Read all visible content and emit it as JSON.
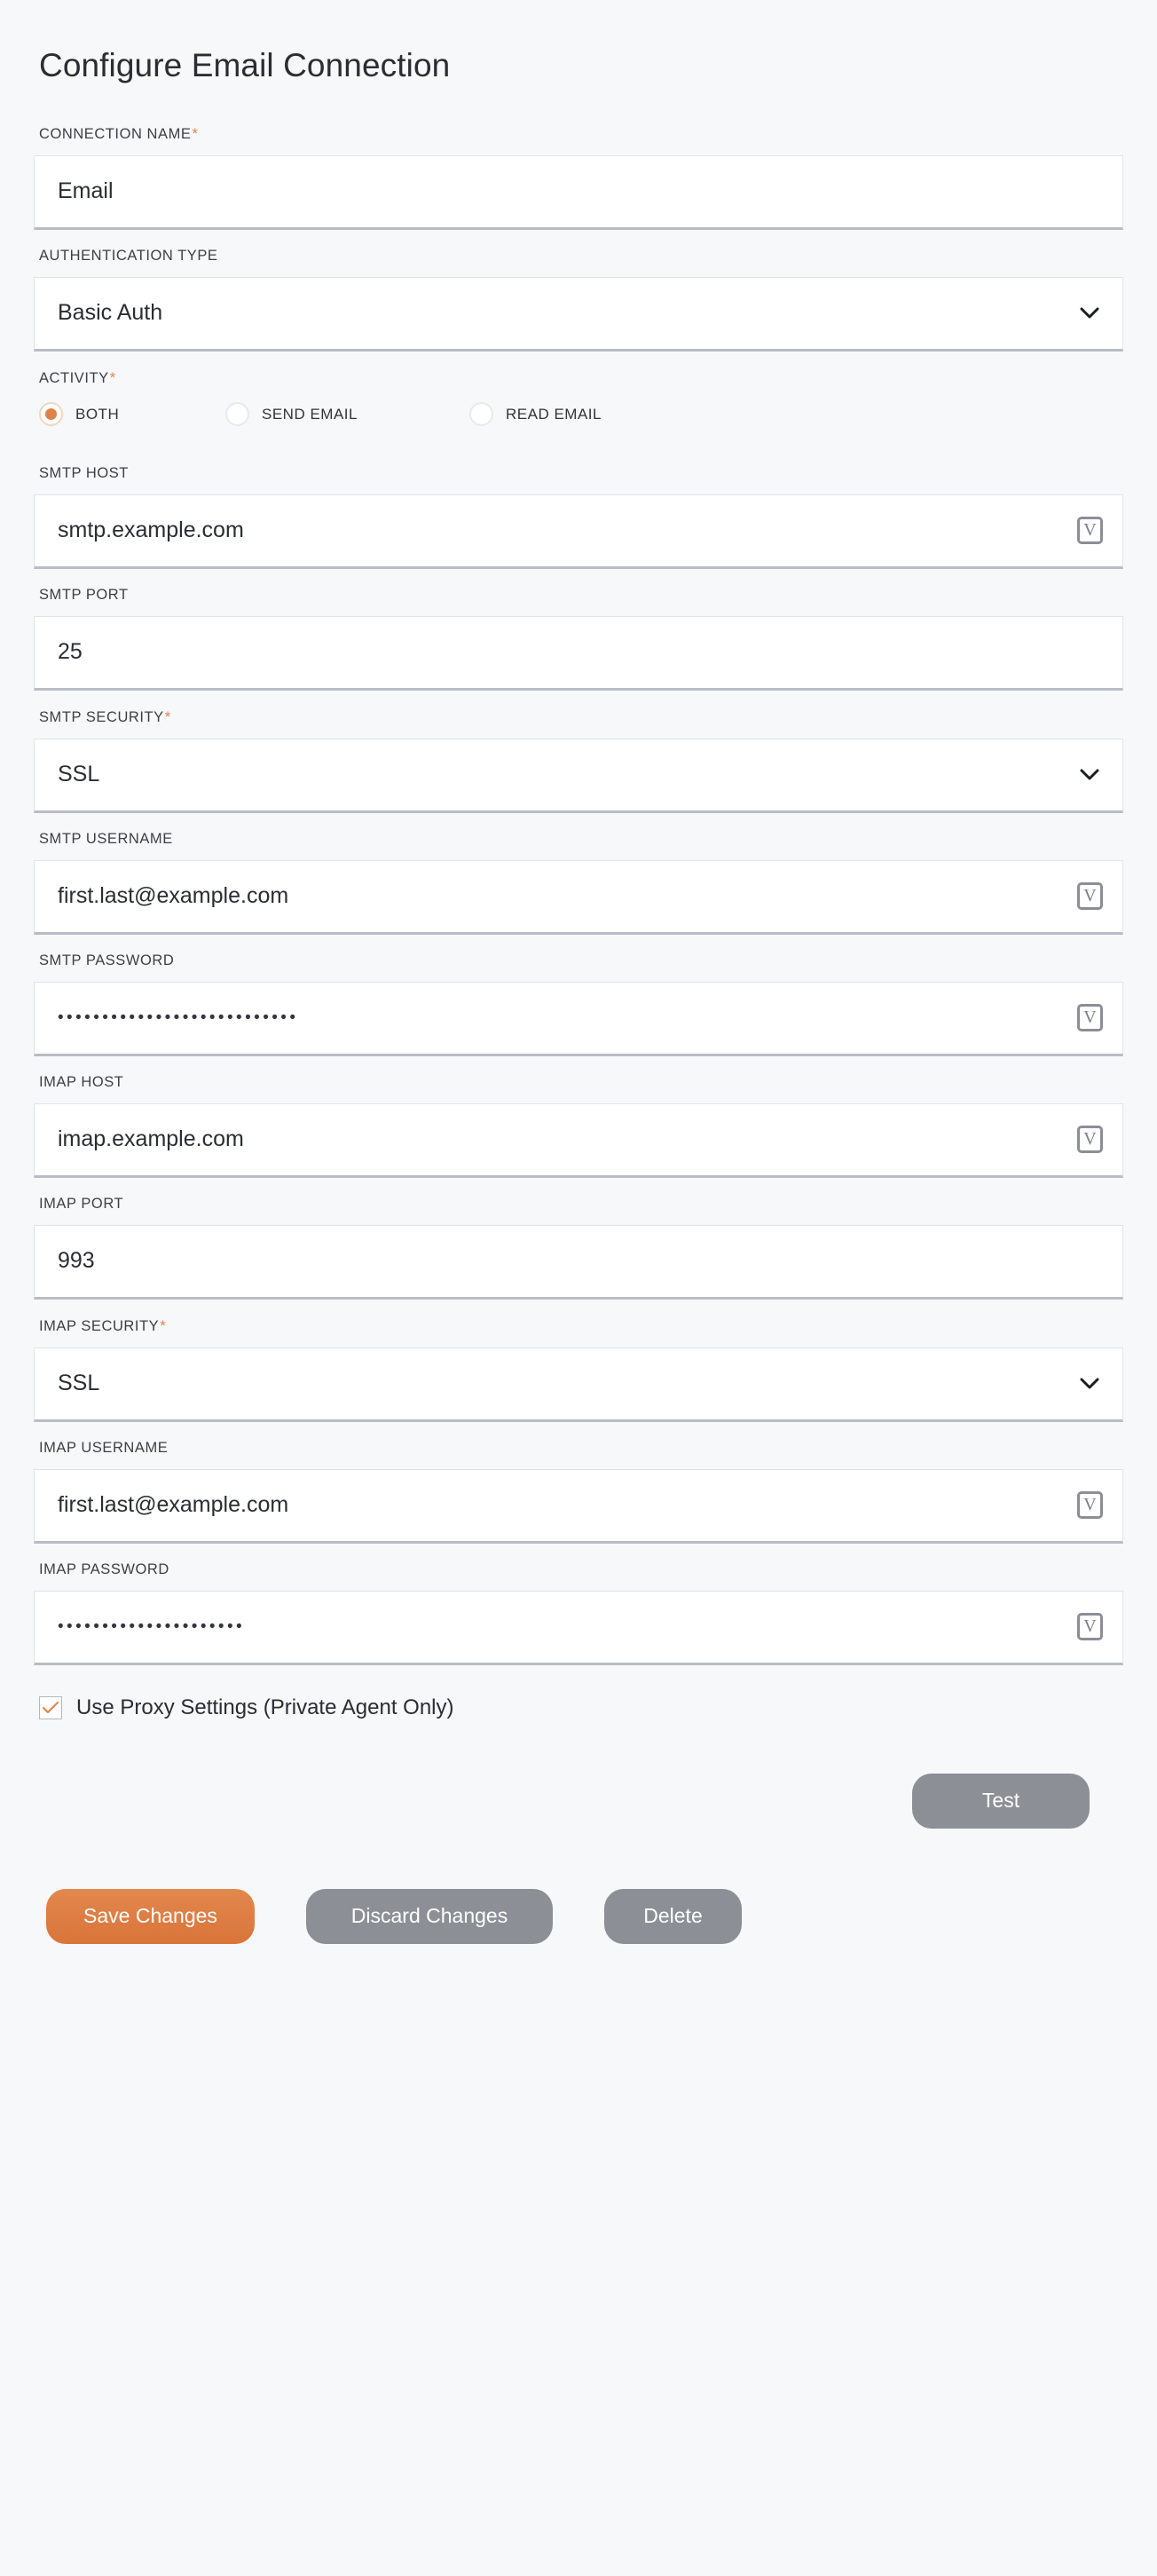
{
  "page": {
    "title": "Configure Email Connection",
    "accent_color": "#e08247",
    "required_marker": "*"
  },
  "fields": [
    {
      "key": "connection_name",
      "label": "CONNECTION NAME",
      "required": true,
      "type": "text",
      "value": "Email",
      "has_variable_icon": false
    },
    {
      "key": "authentication_type",
      "label": "AUTHENTICATION TYPE",
      "required": false,
      "type": "select",
      "value": "Basic Auth",
      "has_variable_icon": false
    },
    {
      "key": "smtp_host",
      "label": "SMTP HOST",
      "required": false,
      "type": "text",
      "value": "smtp.example.com",
      "has_variable_icon": true
    },
    {
      "key": "smtp_port",
      "label": "SMTP PORT",
      "required": false,
      "type": "text",
      "value": "25",
      "has_variable_icon": false
    },
    {
      "key": "smtp_security",
      "label": "SMTP SECURITY",
      "required": true,
      "type": "select",
      "value": "SSL",
      "has_variable_icon": false
    },
    {
      "key": "smtp_username",
      "label": "SMTP USERNAME",
      "required": false,
      "type": "text",
      "value": "first.last@example.com",
      "has_variable_icon": true
    },
    {
      "key": "smtp_password",
      "label": "SMTP PASSWORD",
      "required": false,
      "type": "password",
      "value": "•••••••••••••••••••••••••••",
      "has_variable_icon": true
    },
    {
      "key": "imap_host",
      "label": "IMAP HOST",
      "required": false,
      "type": "text",
      "value": "imap.example.com",
      "has_variable_icon": true
    },
    {
      "key": "imap_port",
      "label": "IMAP PORT",
      "required": false,
      "type": "text",
      "value": "993",
      "has_variable_icon": false
    },
    {
      "key": "imap_security",
      "label": "IMAP SECURITY",
      "required": true,
      "type": "select",
      "value": "SSL",
      "has_variable_icon": false
    },
    {
      "key": "imap_username",
      "label": "IMAP USERNAME",
      "required": false,
      "type": "text",
      "value": "first.last@example.com",
      "has_variable_icon": true
    },
    {
      "key": "imap_password",
      "label": "IMAP PASSWORD",
      "required": false,
      "type": "password",
      "value": "•••••••••••••••••••••",
      "has_variable_icon": true
    }
  ],
  "activity": {
    "label": "ACTIVITY",
    "required": true,
    "options": [
      {
        "label": "BOTH",
        "selected": true
      },
      {
        "label": "SEND EMAIL",
        "selected": false
      },
      {
        "label": "READ EMAIL",
        "selected": false
      }
    ]
  },
  "proxy": {
    "label": "Use Proxy Settings (Private Agent Only)",
    "checked": true
  },
  "buttons": {
    "test": "Test",
    "save": "Save Changes",
    "discard": "Discard Changes",
    "delete": "Delete"
  },
  "icons": {
    "variable": "V",
    "chevron_down": "chevron-down-icon",
    "check": "check-icon"
  }
}
